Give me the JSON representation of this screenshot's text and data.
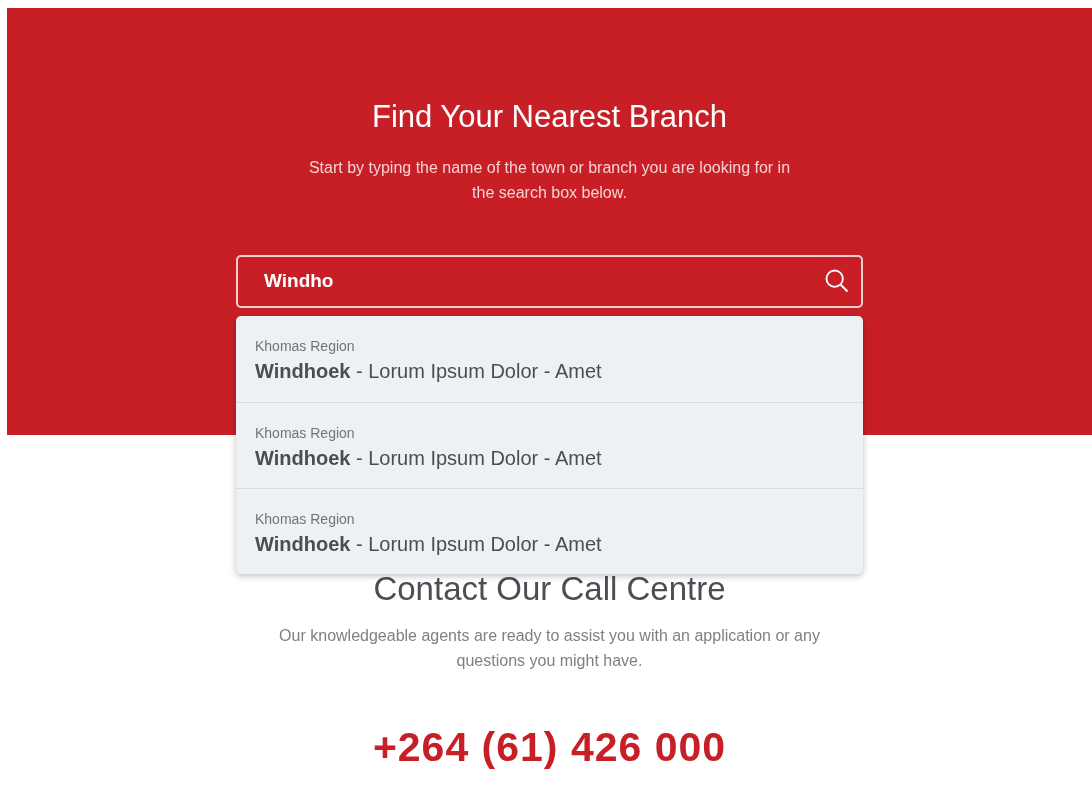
{
  "hero": {
    "title": "Find Your Nearest Branch",
    "subtitle": "Start by typing the name of the town or branch you are looking for in the search box below."
  },
  "search": {
    "value": "Windho"
  },
  "suggestions": [
    {
      "region": "Khomas Region",
      "text": "**Windhoek** - Lorum Ipsum Dolor - Amet"
    },
    {
      "region": "Khomas Region",
      "text": "**Windhoek** - Lorum Ipsum Dolor - Amet"
    },
    {
      "region": "Khomas Region",
      "text": "**Windhoek** - Lorum Ipsum Dolor - Amet"
    }
  ],
  "contact": {
    "title": "Contact Our Call Centre",
    "text": "Our knowledgeable agents are ready to assist you with an application or any questions you might have.",
    "phone": "+264 (61) 426 000"
  }
}
